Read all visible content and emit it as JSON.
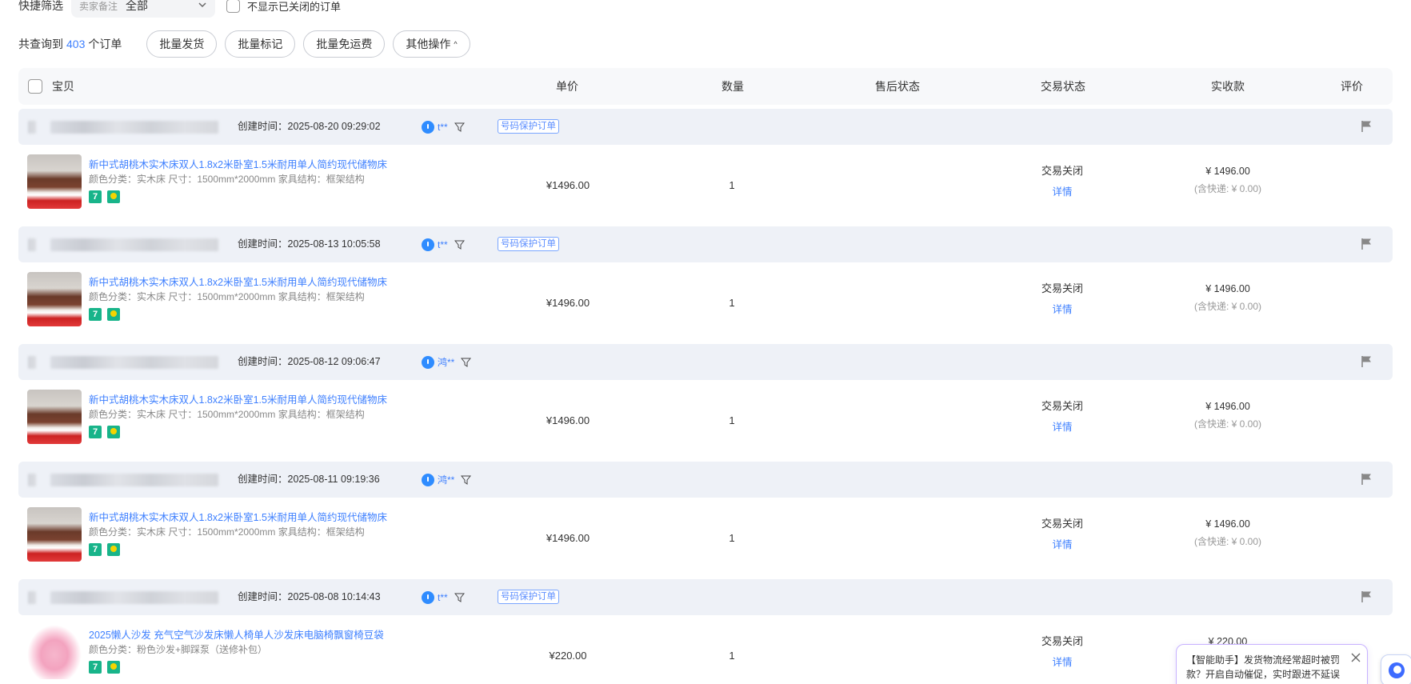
{
  "filter": {
    "label": "快捷筛选",
    "select_prefix": "卖家备注",
    "select_value": "全部",
    "hide_closed_label": "不显示已关闭的订单"
  },
  "actions": {
    "count_prefix": "共查询到",
    "count": "403",
    "count_suffix": "个订单",
    "batch_ship": "批量发货",
    "batch_mark": "批量标记",
    "batch_free_shipping": "批量免运费",
    "other_ops": "其他操作",
    "other_ops_arrow": "^"
  },
  "table_header": {
    "item": "宝贝",
    "unit_price": "单价",
    "quantity": "数量",
    "after_sale": "售后状态",
    "trade_status": "交易状态",
    "paid": "实收款",
    "rating": "评价"
  },
  "orders": [
    {
      "created": "创建时间：2025-08-20 09:29:02",
      "buyer": "t**",
      "protect_tag": "号码保护订单",
      "title": "新中式胡桃木实木床双人1.8x2米卧室1.5米耐用单人简约现代储物床",
      "spec": "颜色分类：实木床   尺寸：1500mm*2000mm   家具结构：框架结构",
      "badge7": "7",
      "price": "¥1496.00",
      "qty": "1",
      "status": "交易关闭",
      "detail": "详情",
      "amount": "¥ 1496.00",
      "shipping": "(含快递: ¥ 0.00)"
    },
    {
      "created": "创建时间：2025-08-13 10:05:58",
      "buyer": "t**",
      "protect_tag": "号码保护订单",
      "title": "新中式胡桃木实木床双人1.8x2米卧室1.5米耐用单人简约现代储物床",
      "spec": "颜色分类：实木床   尺寸：1500mm*2000mm   家具结构：框架结构",
      "badge7": "7",
      "price": "¥1496.00",
      "qty": "1",
      "status": "交易关闭",
      "detail": "详情",
      "amount": "¥ 1496.00",
      "shipping": "(含快递: ¥ 0.00)"
    },
    {
      "created": "创建时间：2025-08-12 09:06:47",
      "buyer": "鸿**",
      "protect_tag": "",
      "title": "新中式胡桃木实木床双人1.8x2米卧室1.5米耐用单人简约现代储物床",
      "spec": "颜色分类：实木床   尺寸：1500mm*2000mm   家具结构：框架结构",
      "badge7": "7",
      "price": "¥1496.00",
      "qty": "1",
      "status": "交易关闭",
      "detail": "详情",
      "amount": "¥ 1496.00",
      "shipping": "(含快递: ¥ 0.00)"
    },
    {
      "created": "创建时间：2025-08-11 09:19:36",
      "buyer": "鸿**",
      "protect_tag": "",
      "title": "新中式胡桃木实木床双人1.8x2米卧室1.5米耐用单人简约现代储物床",
      "spec": "颜色分类：实木床   尺寸：1500mm*2000mm   家具结构：框架结构",
      "badge7": "7",
      "price": "¥1496.00",
      "qty": "1",
      "status": "交易关闭",
      "detail": "详情",
      "amount": "¥ 1496.00",
      "shipping": "(含快递: ¥ 0.00)"
    },
    {
      "created": "创建时间：2025-08-08 10:14:43",
      "buyer": "t**",
      "protect_tag": "号码保护订单",
      "title": "2025懒人沙发 充气空气沙发床懒人椅单人沙发床电脑椅飘窗椅豆袋",
      "spec": "颜色分类：粉色沙发+脚踩泵（送修补包）",
      "badge7": "7",
      "price": "¥220.00",
      "qty": "1",
      "status": "交易关闭",
      "detail": "详情",
      "amount": "¥ 220.00",
      "shipping": ""
    }
  ],
  "assistant": {
    "text": "【智能助手】发货物流经常超时被罚款？开启自动催促，实时跟进不延误"
  },
  "colors": {
    "accent": "#3d7fff",
    "header_bg": "#f7f8fa",
    "order_head_bg": "#eef1f7",
    "badge_green": "#18b48a"
  }
}
